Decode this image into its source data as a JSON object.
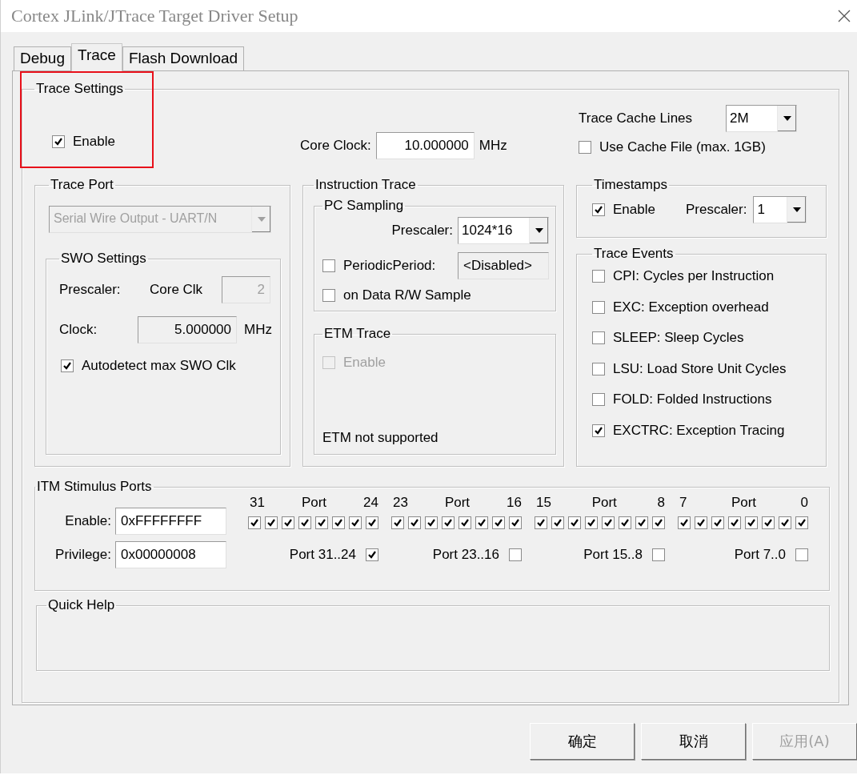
{
  "window": {
    "title": "Cortex JLink/JTrace Target Driver Setup"
  },
  "tabs": [
    {
      "label": "Debug",
      "selected": false
    },
    {
      "label": "Trace",
      "selected": true
    },
    {
      "label": "Flash Download",
      "selected": false
    }
  ],
  "trace_settings": {
    "title": "Trace Settings",
    "highlighted": true,
    "enable": {
      "label": "Enable",
      "checked": true
    },
    "core_clock": {
      "label": "Core Clock:",
      "value": "10.000000",
      "unit": "MHz"
    },
    "trace_cache_lines": {
      "label": "Trace Cache Lines",
      "value": "2M"
    },
    "use_cache_file": {
      "label": "Use Cache File (max. 1GB)",
      "checked": false
    }
  },
  "trace_port": {
    "title": "Trace Port",
    "select": {
      "value": "Serial Wire Output - UART/N",
      "disabled": true
    },
    "swo_settings": {
      "title": "SWO Settings",
      "prescaler": {
        "label": "Prescaler:",
        "sublabel": "Core Clk",
        "value": "2",
        "disabled": true
      },
      "clock": {
        "label": "Clock:",
        "value": "5.000000",
        "unit": "MHz",
        "read_only": true
      },
      "autodetect": {
        "label": "Autodetect max SWO Clk",
        "checked": true
      }
    }
  },
  "instruction_trace": {
    "title": "Instruction Trace",
    "pc_sampling": {
      "title": "PC Sampling",
      "prescaler": {
        "label": "Prescaler:",
        "value": "1024*16"
      },
      "periodic": {
        "label": "PeriodicPeriod:",
        "checked": false,
        "value": "<Disabled>"
      },
      "on_data": {
        "label": "on Data R/W Sample",
        "checked": false
      }
    },
    "etm_trace": {
      "title": "ETM Trace",
      "enable": {
        "label": "Enable",
        "checked": false,
        "disabled": true
      },
      "note": "ETM not supported"
    }
  },
  "timestamps": {
    "title": "Timestamps",
    "enable": {
      "label": "Enable",
      "checked": true
    },
    "prescaler": {
      "label": "Prescaler:",
      "value": "1"
    }
  },
  "trace_events": {
    "title": "Trace Events",
    "items": [
      {
        "label": "CPI: Cycles per Instruction",
        "checked": false
      },
      {
        "label": "EXC: Exception overhead",
        "checked": false
      },
      {
        "label": "SLEEP: Sleep Cycles",
        "checked": false
      },
      {
        "label": "LSU: Load Store Unit Cycles",
        "checked": false
      },
      {
        "label": "FOLD: Folded Instructions",
        "checked": false
      },
      {
        "label": "EXCTRC: Exception Tracing",
        "checked": true
      }
    ]
  },
  "itm": {
    "title": "ITM Stimulus Ports",
    "enable": {
      "label": "Enable:",
      "value": "0xFFFFFFFF"
    },
    "privilege": {
      "label": "Privilege:",
      "value": "0x00000008"
    },
    "groups": [
      {
        "high": "31",
        "label": "Port",
        "low": "24",
        "ports": [
          {
            "checked": true
          },
          {
            "checked": true
          },
          {
            "checked": true
          },
          {
            "checked": true
          },
          {
            "checked": true
          },
          {
            "checked": true
          },
          {
            "checked": true
          },
          {
            "checked": true
          }
        ],
        "privilege": {
          "label": "Port 31..24",
          "checked": true
        }
      },
      {
        "high": "23",
        "label": "Port",
        "low": "16",
        "ports": [
          {
            "checked": true
          },
          {
            "checked": true
          },
          {
            "checked": true
          },
          {
            "checked": true
          },
          {
            "checked": true
          },
          {
            "checked": true
          },
          {
            "checked": true
          },
          {
            "checked": true
          }
        ],
        "privilege": {
          "label": "Port 23..16",
          "checked": false
        }
      },
      {
        "high": "15",
        "label": "Port",
        "low": "8",
        "ports": [
          {
            "checked": true
          },
          {
            "checked": true
          },
          {
            "checked": true
          },
          {
            "checked": true
          },
          {
            "checked": true
          },
          {
            "checked": true
          },
          {
            "checked": true
          },
          {
            "checked": true
          }
        ],
        "privilege": {
          "label": "Port 15..8",
          "checked": false
        }
      },
      {
        "high": "7",
        "label": "Port",
        "low": "0",
        "ports": [
          {
            "checked": true
          },
          {
            "checked": true
          },
          {
            "checked": true
          },
          {
            "checked": true
          },
          {
            "checked": true
          },
          {
            "checked": true
          },
          {
            "checked": true
          },
          {
            "checked": true
          }
        ],
        "privilege": {
          "label": "Port 7..0",
          "checked": false
        }
      }
    ]
  },
  "quick_help": {
    "title": "Quick Help"
  },
  "buttons": [
    {
      "label": "确定",
      "disabled": false
    },
    {
      "label": "取消",
      "disabled": false
    },
    {
      "label": "应用(A)",
      "disabled": true
    }
  ]
}
